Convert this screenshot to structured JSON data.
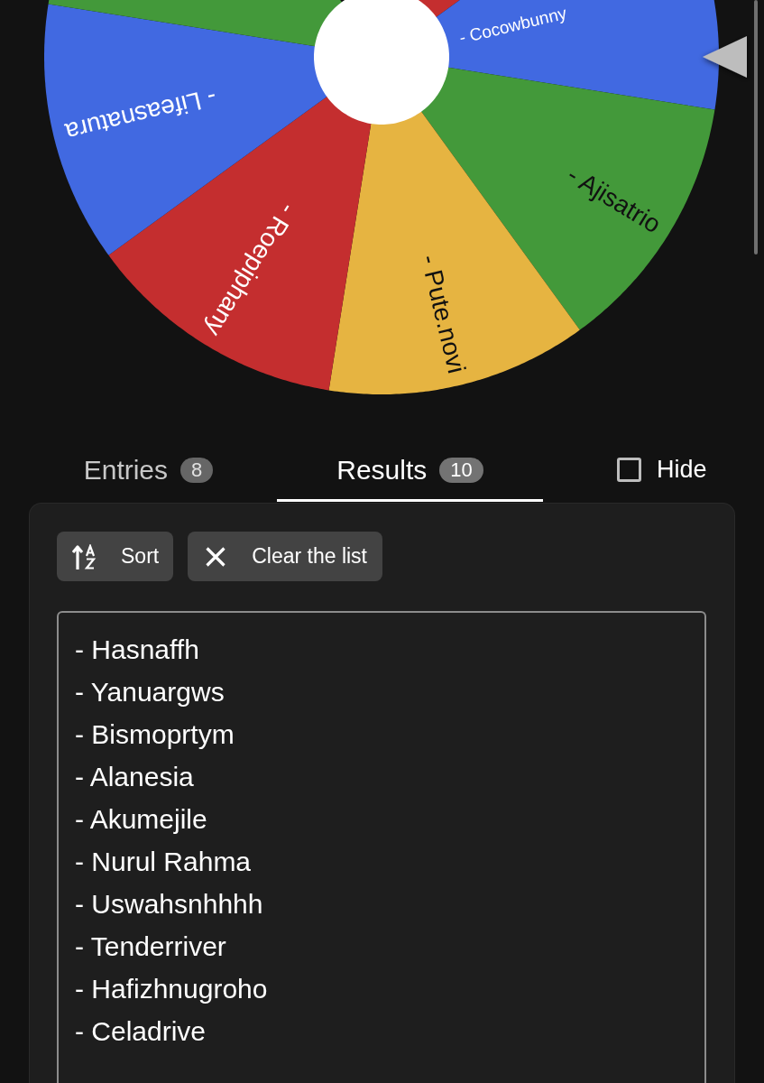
{
  "wheel": {
    "segments": [
      {
        "color": "#c42e2f"
      },
      {
        "color": "#4169e1",
        "label": "- Cocowbunny"
      },
      {
        "color": "#43993a",
        "label": "- Ajisatrio"
      },
      {
        "color": "#e6b441",
        "label": "- Pute.novi"
      },
      {
        "color": "#c42e2f",
        "label": "- Roepiphany"
      },
      {
        "color": "#4169e1",
        "label": "- Lifeasnatura"
      },
      {
        "color": "#43993a"
      }
    ]
  },
  "tabs": [
    {
      "label": "Entries",
      "count": "8",
      "selected": false
    },
    {
      "label": "Results",
      "count": "10",
      "selected": true
    }
  ],
  "hide": {
    "label": "Hide",
    "checked": false
  },
  "toolbar": [
    {
      "kind": "sort",
      "label": "Sort"
    },
    {
      "kind": "clear",
      "label": "Clear the list"
    }
  ],
  "results": [
    "- Hasnaffh",
    "- Yanuargws",
    "- Bismoprtym",
    "- Alanesia",
    "- Akumejile",
    "- Nurul Rahma",
    "- Uswahsnhhhh",
    "- Tenderriver",
    "- Hafizhnugroho",
    "- Celadrive"
  ]
}
